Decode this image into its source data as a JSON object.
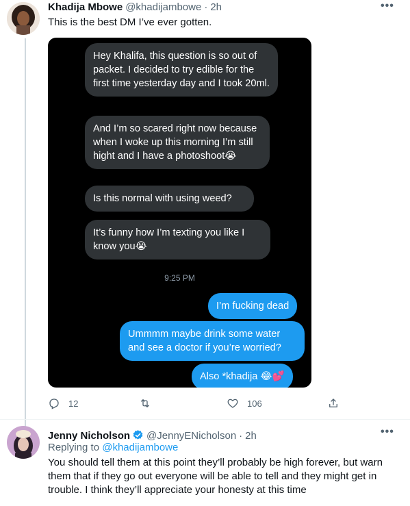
{
  "tweet": {
    "author_name": "Khadija Mbowe",
    "handle": "@khadijambowe",
    "separator": "·",
    "time": "2h",
    "text": "This is the best DM I’ve ever gotten.",
    "more_label": "•••",
    "dm": {
      "messages_in": [
        "Hey Khalifa, this question is so out of packet. I decided to try edible for the first time yesterday day and I took 20ml.",
        "And I’m so scared right now because when I woke up this morning I’m still hight and I have a photoshoot😭",
        "Is this normal with using weed?",
        "It’s funny how I’m texting you like I know you😭"
      ],
      "timestamp": "9:25 PM",
      "messages_out": [
        "I’m fucking dead",
        "Ummmm maybe drink some water and see a doctor if you’re worried?",
        "Also *khadija 😂💕"
      ]
    },
    "actions": {
      "reply_count": "12",
      "retweet_count": "",
      "like_count": "106"
    }
  },
  "reply": {
    "author_name": "Jenny Nicholson",
    "handle": "@JennyENicholson",
    "separator": "·",
    "time": "2h",
    "more_label": "•••",
    "replying_to_label": "Replying to",
    "replying_to_handle": "@khadijambowe",
    "text": "You should tell them at this point they’ll probably be high forever, but warn them that if they go out everyone will be able to tell and they might get in trouble. I think they’ll appreciate your honesty at this time"
  },
  "colors": {
    "accent": "#1d9bf0",
    "text_secondary": "#536471",
    "bubble_incoming": "#2f3336",
    "bubble_outgoing": "#1d9bf0"
  }
}
